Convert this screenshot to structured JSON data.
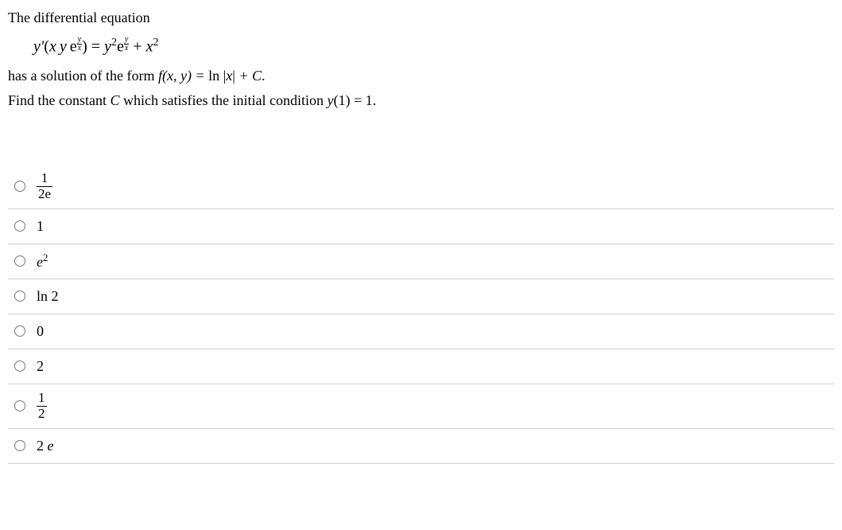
{
  "question": {
    "intro": "The differential equation",
    "equation": {
      "lhs_yprime": "y′",
      "lhs_open": "(",
      "x": "x",
      "y": "y",
      "e": "e",
      "frac_y": "y",
      "frac_x": "x",
      "lhs_close": ")",
      "equals": " = ",
      "y2": "y",
      "sq": "2",
      "plus": " + ",
      "x2": "x"
    },
    "para1_prefix": "has a solution of the form ",
    "para1_fxy": "f(x, y) = ",
    "para1_ln": "ln ",
    "para1_absopen": "|",
    "para1_xvar": "x",
    "para1_absclose": "|",
    "para1_plusC": " + C",
    "para1_dot": ".",
    "para2_prefix": "Find the constant ",
    "para2_C": "C",
    "para2_mid": " which satisfies the initial condition ",
    "para2_y": "y",
    "para2_of1": "(1) = 1",
    "para2_dot": "."
  },
  "options": [
    {
      "display": "frac",
      "num": "1",
      "den": "2e"
    },
    {
      "display": "plain",
      "text": "1"
    },
    {
      "display": "epow2",
      "base": "e",
      "exp": "2"
    },
    {
      "display": "ln2",
      "ln": "ln ",
      "two": "2"
    },
    {
      "display": "plain",
      "text": "0"
    },
    {
      "display": "plain",
      "text": "2"
    },
    {
      "display": "frac",
      "num": "1",
      "den": "2"
    },
    {
      "display": "twoe",
      "two": "2 ",
      "e": "e"
    }
  ]
}
